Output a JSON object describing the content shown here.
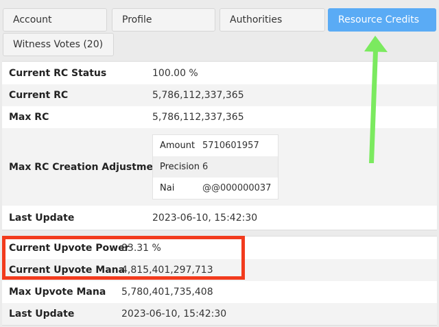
{
  "tabs": [
    {
      "label": "Account"
    },
    {
      "label": "Profile"
    },
    {
      "label": "Authorities"
    },
    {
      "label": "Resource Credits",
      "active": true
    },
    {
      "label": "Witness Votes (20)"
    }
  ],
  "rc": {
    "status_label": "Current RC Status",
    "status_value": "100.00 %",
    "current_label": "Current RC",
    "current_value": "5,786,112,337,365",
    "max_label": "Max RC",
    "max_value": "5,786,112,337,365",
    "adjustment_label": "Max RC Creation Adjustment",
    "adjustment": {
      "amount_label": "Amount",
      "amount_value": "5710601957",
      "precision_label": "Precision",
      "precision_value": "6",
      "nai_label": "Nai",
      "nai_value": "@@000000037"
    },
    "last_update_label": "Last Update",
    "last_update_value": "2023-06-10, 15:42:30"
  },
  "upvote": {
    "power_label": "Current Upvote Power",
    "power_value": "83.31 %",
    "mana_label": "Current Upvote Mana",
    "mana_value": "4,815,401,297,713",
    "max_mana_label": "Max Upvote Mana",
    "max_mana_value": "5,780,401,735,408",
    "last_update_label": "Last Update",
    "last_update_value": "2023-06-10, 15:42:30"
  },
  "colors": {
    "active_tab": "#5aabf5",
    "highlight_box": "#f23b1d",
    "arrow": "#7bea5f"
  }
}
